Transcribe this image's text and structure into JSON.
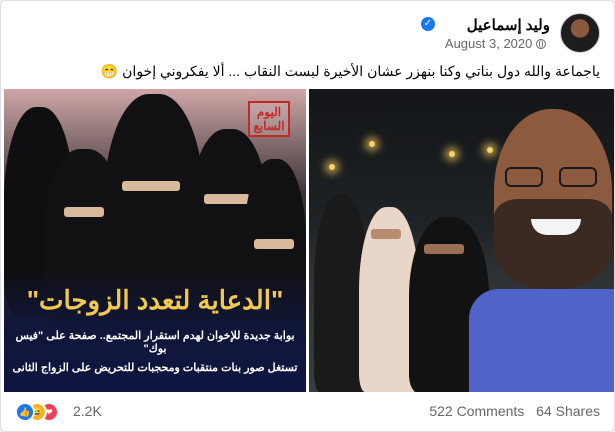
{
  "post": {
    "author": "وليد إسماعيل",
    "verified_mark": "✓",
    "timestamp": "August 3, 2020",
    "privacy_icon": "globe-icon",
    "text": "ياجماعة والله دول بناتي وكنا بنهزر عشان الأخيرة لبست النقاب ... ألا يفكروني إخوان 😁"
  },
  "left_image": {
    "logo_text": "اليوم السابع",
    "headline": "\"الدعاية لتعدد الزوجات\"",
    "subline1": "بوابة جديدة للإخوان لهدم استقرار المجتمع.. صفحة على \"فيس بوك\"",
    "subline2": "تستغل صور بنات منتقبات ومحجبات للتحريض على الزواج الثانى"
  },
  "footer": {
    "reaction_icons": [
      "like-icon",
      "haha-icon",
      "love-icon"
    ],
    "reaction_count": "2.2K",
    "comments": "522 Comments",
    "shares": "64 Shares"
  },
  "colors": {
    "facebook_blue": "#1877f2",
    "headline_yellow": "#f2c94c",
    "shirt_blue": "#4f63c9"
  }
}
